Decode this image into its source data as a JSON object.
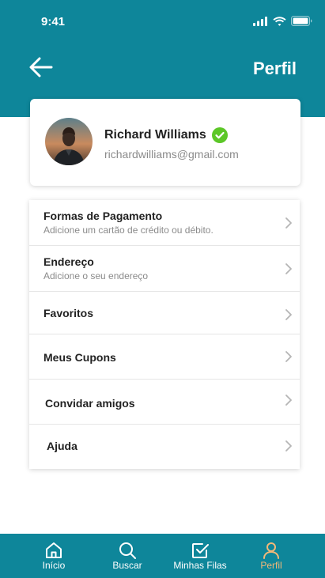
{
  "status": {
    "time": "9:41"
  },
  "header": {
    "title": "Perfil"
  },
  "profile": {
    "name": "Richard Williams",
    "email": "richardwilliams@gmail.com",
    "verified": true
  },
  "menu": {
    "items": [
      {
        "title": "Formas de Pagamento",
        "subtitle": "Adicione um cartão de crédito ou débito."
      },
      {
        "title": "Endereço",
        "subtitle": "Adicione o seu endereço"
      },
      {
        "title": "Favoritos",
        "subtitle": ""
      },
      {
        "title": "Meus Cupons",
        "subtitle": ""
      },
      {
        "title": "Convidar amigos",
        "subtitle": ""
      },
      {
        "title": "Ajuda",
        "subtitle": ""
      }
    ]
  },
  "nav": {
    "items": [
      {
        "label": "Início",
        "icon": "home-icon"
      },
      {
        "label": "Buscar",
        "icon": "search-icon"
      },
      {
        "label": "Minhas Filas",
        "icon": "checkbox-icon"
      },
      {
        "label": "Perfil",
        "icon": "user-icon",
        "active": true
      }
    ]
  },
  "colors": {
    "primary": "#0e869a",
    "active_nav": "#f2b878",
    "verified": "#5cc727"
  }
}
